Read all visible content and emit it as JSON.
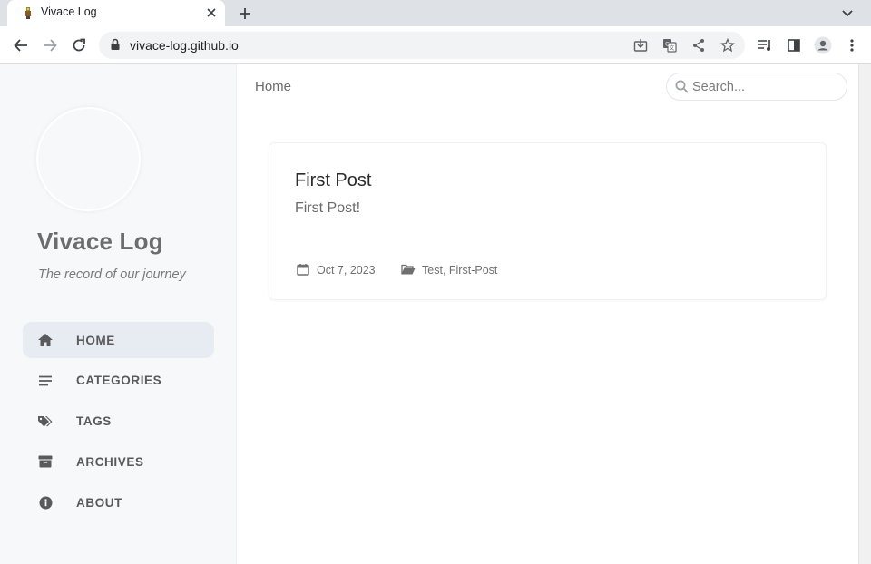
{
  "browser": {
    "tab_title": "Vivace Log",
    "url": "vivace-log.github.io"
  },
  "sidebar": {
    "site_title": "Vivace Log",
    "subtitle": "The record of our journey",
    "items": [
      {
        "label": "HOME",
        "icon": "home-icon",
        "active": true
      },
      {
        "label": "CATEGORIES",
        "icon": "list-icon"
      },
      {
        "label": "TAGS",
        "icon": "tags-icon"
      },
      {
        "label": "ARCHIVES",
        "icon": "archive-icon"
      },
      {
        "label": "ABOUT",
        "icon": "info-icon"
      }
    ]
  },
  "topbar": {
    "breadcrumb": "Home",
    "search_placeholder": "Search..."
  },
  "post": {
    "title": "First Post",
    "excerpt": "First Post!",
    "date": "Oct 7, 2023",
    "categories": [
      "Test",
      "First-Post"
    ],
    "category_separator": ", "
  },
  "colors": {
    "sidebar_bg": "#f6f8fa",
    "active_item_bg": "#e7ecf2"
  }
}
